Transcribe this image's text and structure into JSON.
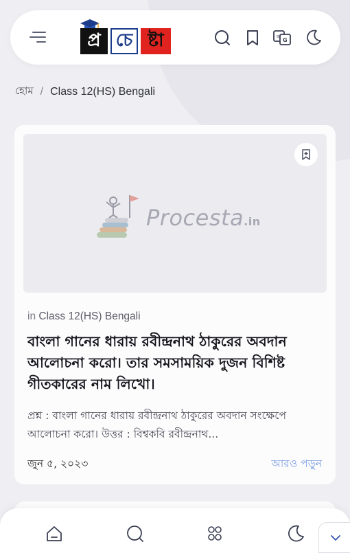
{
  "header": {
    "logo_letters": [
      "প্র",
      "চে",
      "ষ্টা"
    ],
    "icons": [
      "menu-icon",
      "search-icon",
      "bookmark-icon",
      "translate-icon",
      "dark-mode-icon"
    ]
  },
  "breadcrumb": {
    "home": "হোম",
    "separator": "/",
    "current": "Class 12(HS) Bengali"
  },
  "post": {
    "watermark_text": "Procesta",
    "watermark_suffix": ".in",
    "category_prefix": "in",
    "category": "Class 12(HS) Bengali",
    "title": "বাংলা গানের ধারায় রবীন্দ্রনাথ ঠাকুরের অবদান আলোচনা করো। তার সমসাময়িক দুজন বিশিষ্ট গীতকারের নাম লিখো।",
    "excerpt": "প্রশ্ন :  বাংলা গানের ধারায় রবীন্দ্রনাথ ঠাকুরের অবদান সংক্ষেপে আলোচনা করো।  উত্তর : বিশ্বকবি রবীন্দ্রনাথ...",
    "date": "জুন ৫, ২০২৩",
    "read_more": "আরও পড়ুন"
  },
  "bottom_nav": {
    "icons": [
      "home-icon",
      "search-icon",
      "categories-icon",
      "dark-mode-icon",
      "chevron-down-icon"
    ]
  },
  "colors": {
    "background": "#efeff3",
    "card": "#fcfcfd",
    "read_more": "#7b9de0",
    "logo_red": "#e0231f",
    "logo_blue": "#1c3c8c"
  }
}
